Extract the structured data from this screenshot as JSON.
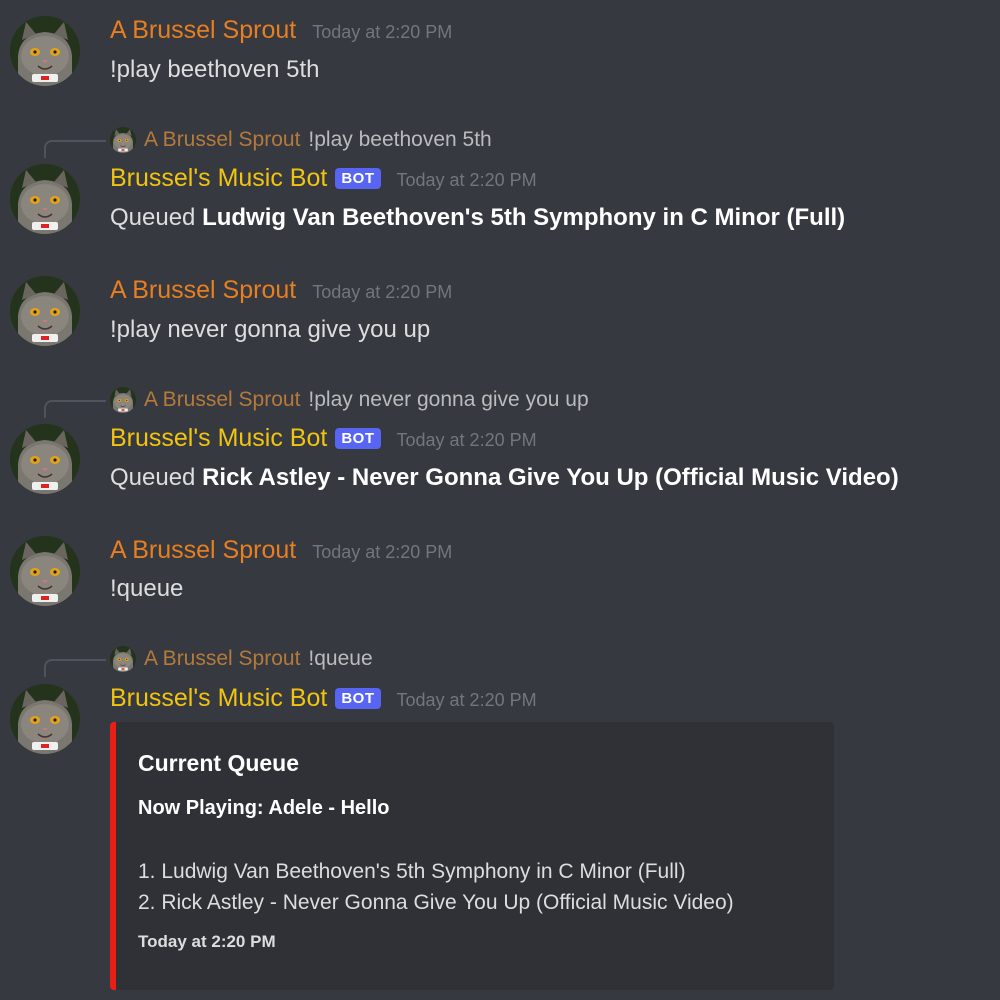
{
  "colors": {
    "background": "#36393f",
    "user_name": "#e67e22",
    "bot_name": "#f1c40f",
    "bot_tag": "#5865f2",
    "embed_accent": "#e91e16",
    "embed_bg": "#2f3136"
  },
  "messages": [
    {
      "author": "A Brussel Sprout",
      "timestamp": "Today at 2:20 PM",
      "text": "!play beethoven 5th"
    },
    {
      "reply": {
        "author": "A Brussel Sprout",
        "text": "!play beethoven 5th"
      },
      "author": "Brussel's Music Bot",
      "bot_tag": "BOT",
      "timestamp": "Today at 2:20 PM",
      "prefix": "Queued",
      "song": "Ludwig Van Beethoven's 5th Symphony in C Minor (Full)"
    },
    {
      "author": "A Brussel Sprout",
      "timestamp": "Today at 2:20 PM",
      "text": "!play never gonna give you up"
    },
    {
      "reply": {
        "author": "A Brussel Sprout",
        "text": "!play never gonna give you up"
      },
      "author": "Brussel's Music Bot",
      "bot_tag": "BOT",
      "timestamp": "Today at 2:20 PM",
      "prefix": "Queued",
      "song": "Rick Astley - Never Gonna Give You Up (Official Music Video)"
    },
    {
      "author": "A Brussel Sprout",
      "timestamp": "Today at 2:20 PM",
      "text": "!queue"
    },
    {
      "reply": {
        "author": "A Brussel Sprout",
        "text": "!queue"
      },
      "author": "Brussel's Music Bot",
      "bot_tag": "BOT",
      "timestamp": "Today at 2:20 PM",
      "embed": {
        "title": "Current Queue",
        "now_playing": "Now Playing: Adele - Hello",
        "items": [
          "1. Ludwig Van Beethoven's 5th Symphony in C Minor (Full)",
          "2. Rick Astley - Never Gonna Give You Up (Official Music Video)"
        ],
        "footer": "Today at 2:20 PM"
      }
    }
  ]
}
